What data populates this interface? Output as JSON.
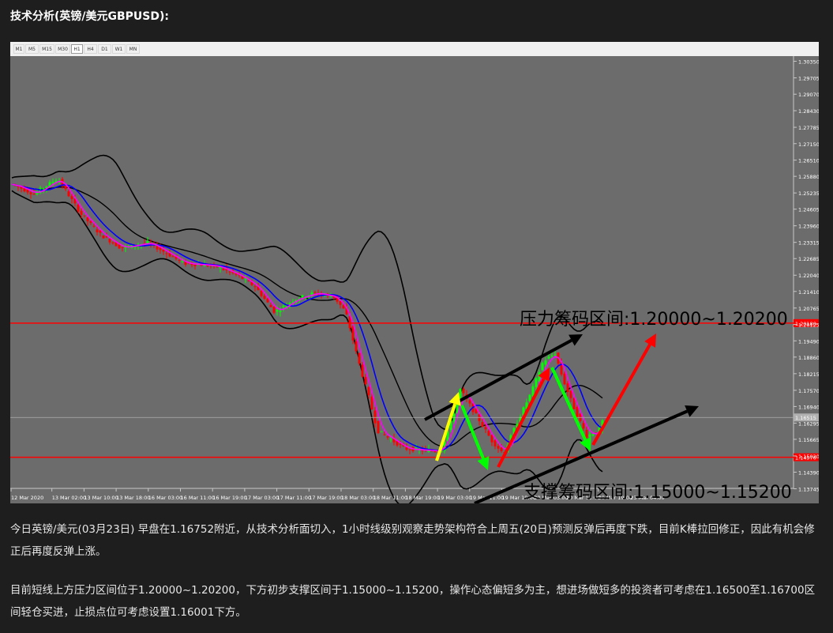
{
  "title": "技术分析(英镑/美元GBPUSD):",
  "toolbar": {
    "timeframes": [
      "M1",
      "M5",
      "M15",
      "M30",
      "H1",
      "H4",
      "D1",
      "W1",
      "MN"
    ],
    "active": "H1"
  },
  "chart_data": {
    "type": "candlestick",
    "symbol": "GBPUSD",
    "timeframe": "H1",
    "ylim": [
      1.1376,
      1.3055
    ],
    "y_ticks": [
      1.3035,
      1.29705,
      1.2907,
      1.2843,
      1.27785,
      1.2715,
      1.2651,
      1.2588,
      1.25235,
      1.24605,
      1.2396,
      1.23315,
      1.22685,
      1.2204,
      1.2141,
      1.20765,
      1.20125,
      1.1949,
      1.1886,
      1.18215,
      1.1757,
      1.1694,
      1.16295,
      1.15665,
      1.1502,
      1.1439,
      1.13745
    ],
    "y_tick_labels": [
      "1.30350",
      "1.29705",
      "1.29070",
      "1.28430",
      "1.27785",
      "1.27150",
      "1.26510",
      "1.25880",
      "1.25235",
      "1.24605",
      "1.23960",
      "1.23315",
      "1.22685",
      "1.22040",
      "1.21410",
      "1.20765",
      "1.20125",
      "1.19490",
      "1.18860",
      "1.18215",
      "1.17570",
      "1.16940",
      "1.16295",
      "1.15665",
      "1.15020",
      "1.14390",
      "1.13745"
    ],
    "x_labels": [
      "12 Mar 2020",
      "13 Mar 02:00",
      "13 Mar 10:00",
      "13 Mar 18:00",
      "16 Mar 03:00",
      "16 Mar 11:00",
      "16 Mar 19:00",
      "17 Mar 03:00",
      "17 Mar 11:00",
      "17 Mar 19:00",
      "18 Mar 03:00",
      "18 Mar 11:00",
      "18 Mar 19:00",
      "19 Mar 03:00",
      "19 Mar 11:00",
      "19 Mar 19:00",
      "20 Mar 03:00",
      "20 Mar 11:00",
      "20 Mar 19:00",
      "23 Mar 04:00"
    ],
    "horizontal_lines": [
      {
        "value": 1.2018,
        "label": "1.20180",
        "color": "#ff0000"
      },
      {
        "value": 1.1497,
        "label": "1.14970",
        "color": "#ff0000"
      },
      {
        "value": 1.16515,
        "label": "1.16515",
        "color": "#b0b0b0"
      }
    ],
    "current_price": "1.16515",
    "annotations": {
      "resistance": "压力筹码区间:1.20000~1.20200",
      "support": "支撑筹码区间:1.15000~1.15200"
    }
  },
  "paragraphs": [
    "今日英镑/美元(03月23日) 早盘在1.16752附近，从技术分析面切入，1小时线级别观察走势架构符合上周五(20日)预测反弹后再度下跌，目前K棒拉回修正，因此有机会修正后再度反弹上涨。",
    "目前短线上方压力区间位于1.20000~1.20200，下方初步支撑区间于1.15000~1.15200，操作心态偏短多为主，想进场做短多的投资者可考虑在1.16500至1.16700区间轻仓买进，止损点位可考虑设置1.16001下方。"
  ],
  "colors": {
    "chart_bg": "#6c6c6c",
    "bull": "#00ff00",
    "bear": "#ff0000",
    "ma_fast": "#ff00ff",
    "ma_slow": "#0000ff",
    "bands": "#000000",
    "arrow_up_1": "#ffff00",
    "arrow_down": "#00ff00",
    "arrow_up_2": "#ff0000"
  }
}
